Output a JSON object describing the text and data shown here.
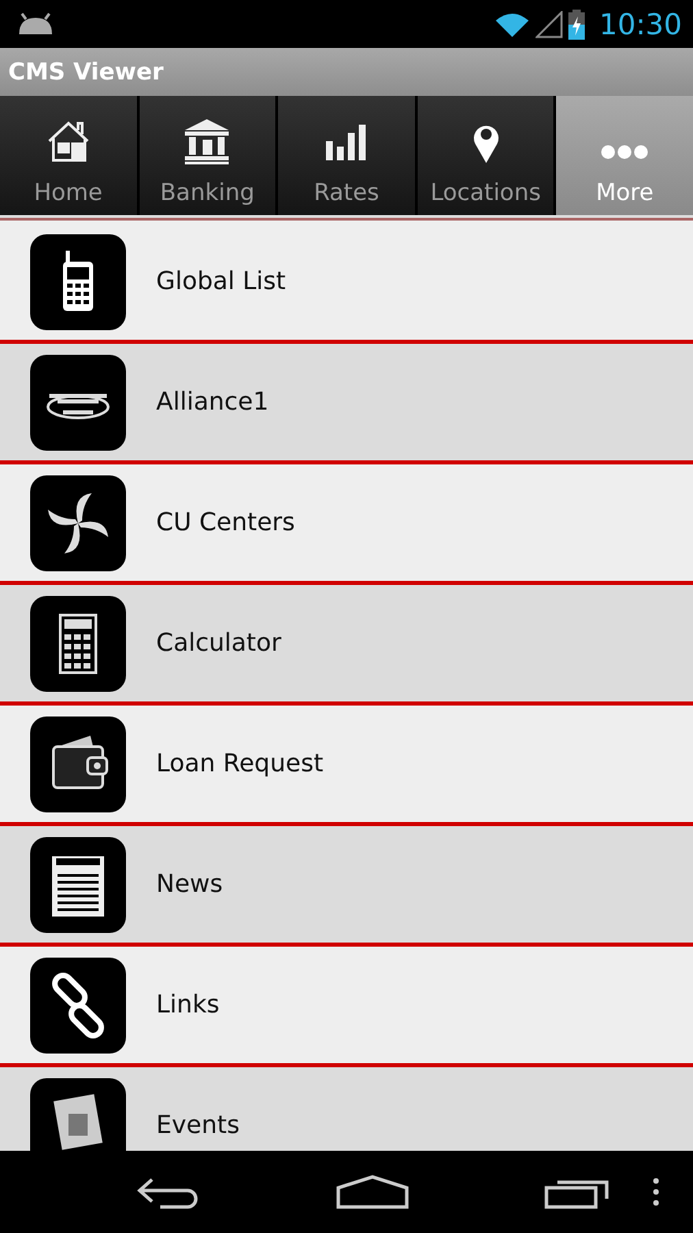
{
  "status_bar": {
    "time": "10:30"
  },
  "app_bar": {
    "title": "CMS Viewer"
  },
  "tabs": [
    {
      "label": "Home",
      "kind": "home",
      "selected": false
    },
    {
      "label": "Banking",
      "kind": "bank",
      "selected": false
    },
    {
      "label": "Rates",
      "kind": "chart",
      "selected": false
    },
    {
      "label": "Locations",
      "kind": "pin",
      "selected": false
    },
    {
      "label": "More",
      "kind": "dots",
      "selected": true
    }
  ],
  "menu_items": [
    {
      "label": "Global List",
      "kind": "phone"
    },
    {
      "label": "Alliance1",
      "kind": "emblem"
    },
    {
      "label": "CU Centers",
      "kind": "swirl"
    },
    {
      "label": "Calculator",
      "kind": "calculator"
    },
    {
      "label": "Loan Request",
      "kind": "wallet"
    },
    {
      "label": "News",
      "kind": "newspaper"
    },
    {
      "label": "Links",
      "kind": "chain"
    },
    {
      "label": "Events",
      "kind": "calendar"
    }
  ]
}
